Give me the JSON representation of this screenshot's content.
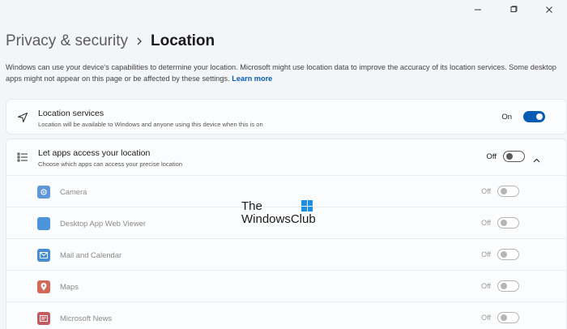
{
  "window_controls": [
    {
      "name": "minimize-icon",
      "glyph": "—"
    },
    {
      "name": "restore-icon",
      "glyph": "❐"
    },
    {
      "name": "close-icon",
      "glyph": "✕"
    }
  ],
  "breadcrumb": {
    "parent": "Privacy & security",
    "current": "Location"
  },
  "description": {
    "text": "Windows can use your device's capabilities to determine your location. Microsoft might use location data to improve the accuracy of its location services. Some desktop apps might not appear on this page or be affected by these settings.",
    "link": "Learn more"
  },
  "location_services": {
    "title": "Location services",
    "subtitle": "Location will be available to Windows and anyone using this device when this is on",
    "state": "On",
    "icon": "navigation-arrow-icon"
  },
  "apps_access": {
    "title": "Let apps access your location",
    "subtitle": "Choose which apps can access your precise location",
    "state": "Off",
    "icon": "list-icon",
    "apps": [
      {
        "name": "Camera",
        "state": "Off",
        "icon": "camera-app-icon",
        "color": "#3a7fd0"
      },
      {
        "name": "Desktop App Web Viewer",
        "state": "Off",
        "icon": "web-viewer-app-icon",
        "color": "#1f78d1"
      },
      {
        "name": "Mail and Calendar",
        "state": "Off",
        "icon": "mail-app-icon",
        "color": "#1a73c8"
      },
      {
        "name": "Maps",
        "state": "Off",
        "icon": "maps-app-icon",
        "color": "#c8452f"
      },
      {
        "name": "Microsoft News",
        "state": "Off",
        "icon": "news-app-icon",
        "color": "#b9303a"
      }
    ]
  },
  "watermark": {
    "line1": "The",
    "line2": "WindowsClub"
  },
  "colors": {
    "accent": "#0a5bb5",
    "background": "#f3f5f9",
    "card": "#fbfcfd"
  }
}
